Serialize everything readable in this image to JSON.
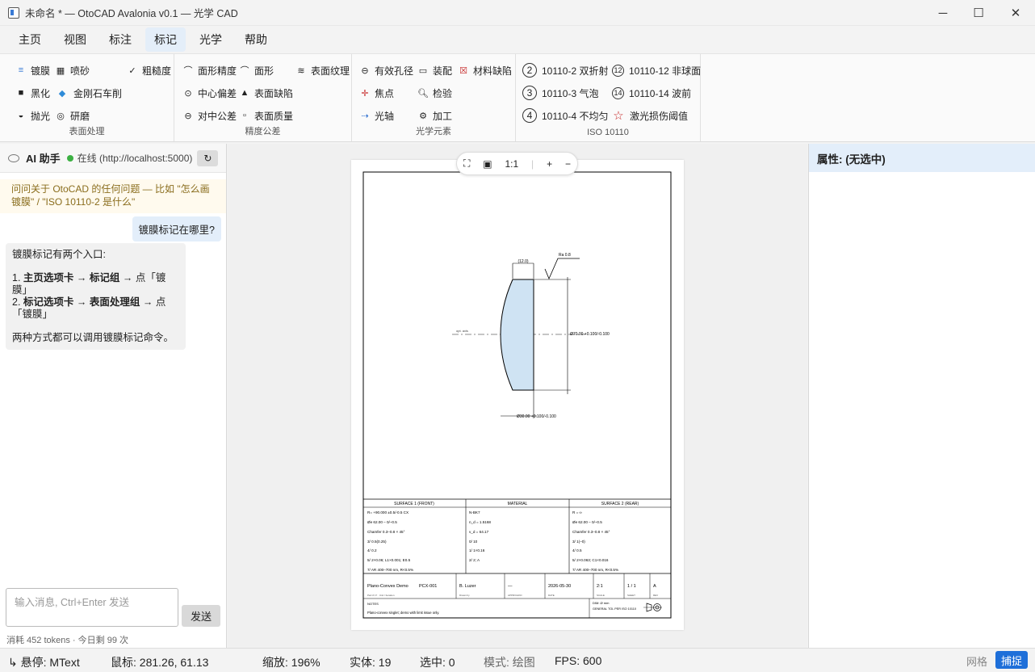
{
  "window": {
    "title": "未命名 * — OtoCAD Avalonia v0.1 — 光学 CAD",
    "minimize": "─",
    "maximize": "☐",
    "close": "✕"
  },
  "menu": {
    "tabs": [
      {
        "label": "主页"
      },
      {
        "label": "视图"
      },
      {
        "label": "标注"
      },
      {
        "label": "标记"
      },
      {
        "label": "光学"
      },
      {
        "label": "帮助"
      }
    ],
    "active": "标记"
  },
  "ribbon": {
    "surface": {
      "label": "表面处理",
      "coating": "镀膜",
      "sandblast": "喷砂",
      "roughness": "粗糙度",
      "blacken": "黑化",
      "diamond": "金刚石车削",
      "polish": "抛光",
      "grind": "研磨"
    },
    "precision": {
      "label": "精度公差",
      "form": "面形精度",
      "shape": "面形",
      "texture": "表面纹理",
      "centering": "中心偏差",
      "defect": "表面缺陷",
      "centration": "对中公差",
      "quality": "表面质量"
    },
    "optical": {
      "label": "光学元素",
      "aperture": "有效孔径",
      "assembly": "装配",
      "material_defect": "材料缺陷",
      "focus": "焦点",
      "inspect": "检验",
      "axis": "光轴",
      "process": "加工"
    },
    "iso": {
      "label": "ISO 10110",
      "items": [
        {
          "num": "2",
          "text": "10110-2 双折射"
        },
        {
          "num": "12",
          "text": "10110-12 非球面"
        },
        {
          "num": "3",
          "text": "10110-3 气泡"
        },
        {
          "num": "14",
          "text": "10110-14 波前"
        },
        {
          "num": "4",
          "text": "10110-4 不均匀"
        },
        {
          "num": "☆",
          "text": "激光损伤阈值"
        }
      ]
    }
  },
  "assistant": {
    "title": "AI 助手",
    "status": "在线 (http://localhost:5000)",
    "hint": "问问关于 OtoCAD 的任何问题 — 比如 \"怎么画镀膜\" / \"ISO 10110-2 是什么\"",
    "user_msg": "镀膜标记在哪里?",
    "reply_intro": "镀膜标记有两个入口:",
    "reply_1_a": "1. ",
    "reply_1_b": "主页选项卡",
    "reply_1_c": " → ",
    "reply_1_d": "标记组",
    "reply_1_e": " → 点「镀膜」",
    "reply_2_a": "2. ",
    "reply_2_b": "标记选项卡",
    "reply_2_c": " → ",
    "reply_2_d": "表面处理组",
    "reply_2_e": " → 点「镀膜」",
    "reply_outro": "两种方式都可以调用镀膜标记命令。",
    "placeholder": "输入消息, Ctrl+Enter 发送",
    "send": "发送",
    "usage": "消耗 452 tokens · 今日剩 99 次"
  },
  "zoom": {
    "fit": "⛶",
    "frame": "▣",
    "one": "1:1",
    "plus": "+",
    "minus": "−"
  },
  "drawing": {
    "roughness_label": "Ra 0.8",
    "thickness_label": "(12.0)",
    "axis_label": "opt. axis",
    "diameter_label": "Ø70.00 +0.100/-0.100",
    "bottom_label": "Ø30.00 +0.100/-0.100",
    "headers": {
      "s1": "SURFACE 1 (FRONT)",
      "mat": "MATERIAL",
      "s2": "SURFACE 2 (REAR)"
    },
    "s1_rows": [
      "R= +90.000 ±0.5/-0.5 CX",
      "Øe 62.00 – 0/–0.5",
      "Chamfer 0.3–0.8 × 45°",
      "3/ 0.5(0.25)",
      "4/ 0.2",
      "5/ 2×0.06; L1×0.001; E0.5",
      "7/ AR 400–700 nm, R<0.5%"
    ],
    "mat_rows": [
      "N-BK7",
      "n_d = 1.5168",
      "v_d = 64.17",
      "0/ 10",
      "1/ 1×0.16",
      "2/ 2; A"
    ],
    "s2_rows": [
      "R = ∞",
      "Øe 62.00 – 0/–0.5",
      "Chamfer 0.3–0.8 × 45°",
      "3/ 1(–0)",
      "4/ 0.5",
      "5/ 2×0.063; C1×0.016",
      "7/ AR 400–700 nm, R<0.5%"
    ],
    "tb_title": "Plano-Convex Demo",
    "tb_part": "PCX-001",
    "tb_author": "B. Luzer",
    "tb_check": "—",
    "tb_date": "2026-05-30",
    "tb_scale": "2:1",
    "tb_sheet": "1 / 1",
    "tb_rev": "A",
    "tb_sub1": "Part # 17 · Unit / Iteration",
    "tb_sub2": "Drawn by",
    "tb_sub3": "APPR/CHKD",
    "tb_sub4": "DATE",
    "tb_sub5": "SCALE",
    "tb_sub6": "SHEET",
    "tb_sub7": "REV",
    "notes_title": "NOTES",
    "notes_text": "Plano-convex singlet; demo with limit issue only.",
    "dims_text": "DIM: Ø mm",
    "general_tol": "GENERAL TOL PER ISO 10110"
  },
  "properties": {
    "title": "属性: (无选中)"
  },
  "status": {
    "hover": "↳ 悬停: MText",
    "mouse": "鼠标: 281.26, 61.13",
    "zoom": "缩放: 196%",
    "entities": "实体: 19",
    "selected": "选中: 0",
    "mode": "模式: 绘图",
    "fps": "FPS: 600",
    "grid": "网格",
    "snap": "捕捉"
  },
  "colors": {
    "accent": "#1e6fd9",
    "online": "#3cb043",
    "lens_fill": "#cfe3f3"
  }
}
